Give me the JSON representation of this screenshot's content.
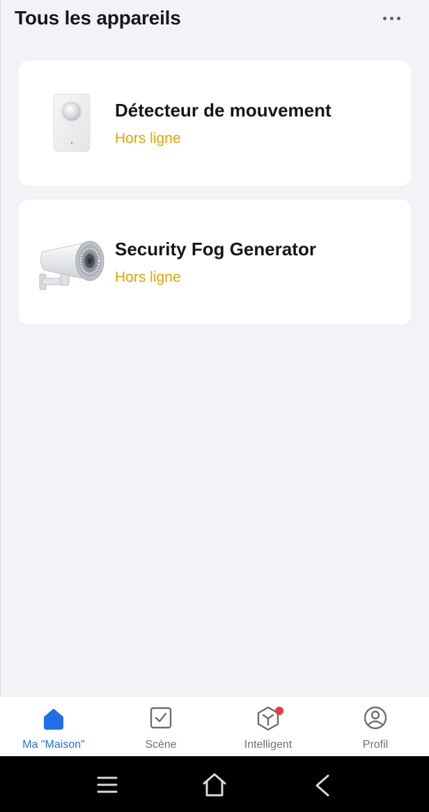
{
  "header": {
    "title": "Tous les appareils",
    "more_icon": "more-horizontal-icon"
  },
  "devices": [
    {
      "name": "Détecteur de mouvement",
      "status": "Hors ligne",
      "icon": "motion-sensor-image"
    },
    {
      "name": "Security Fog Generator",
      "status": "Hors ligne",
      "icon": "fog-generator-image"
    }
  ],
  "tabbar": {
    "tabs": [
      {
        "label": "Ma \"Maison\"",
        "icon": "home-icon",
        "active": true
      },
      {
        "label": "Scène",
        "icon": "scene-check-icon",
        "active": false
      },
      {
        "label": "Intelligent",
        "icon": "smart-cube-icon",
        "active": false,
        "badge": true
      },
      {
        "label": "Profil",
        "icon": "profile-icon",
        "active": false
      }
    ]
  },
  "system_nav": {
    "buttons": [
      "recents-icon",
      "home-nav-icon",
      "back-icon"
    ]
  },
  "colors": {
    "background": "#f2f3f7",
    "accent": "#1f6fe5",
    "offline_status": "#e6a200",
    "badge": "#ee3b3b"
  }
}
